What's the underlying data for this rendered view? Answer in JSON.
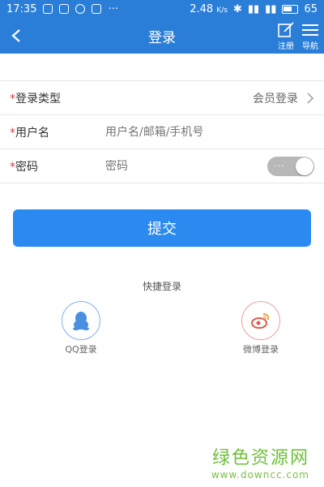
{
  "status_bar": {
    "time": "17:35",
    "speed": "2.48",
    "speed_unit": "K/s",
    "battery": "65"
  },
  "nav": {
    "title": "登录",
    "register_label": "注册",
    "guide_label": "导航"
  },
  "form": {
    "login_type": {
      "required_mark": "*",
      "label": "登录类型",
      "value": "会员登录"
    },
    "username": {
      "required_mark": "*",
      "label": "用户名",
      "placeholder": "用户名/邮箱/手机号"
    },
    "password": {
      "required_mark": "*",
      "label": "密码",
      "placeholder": "密码",
      "show_toggle_dots": "···"
    }
  },
  "submit_label": "提交",
  "quick_login": {
    "title": "快捷登录",
    "qq_label": "QQ登录",
    "weibo_label": "微博登录"
  },
  "watermark": {
    "main": "绿色资源网",
    "sub": "www.downcc.com"
  },
  "colors": {
    "primary": "#2b7ed8",
    "button": "#2b8af0",
    "required": "#e23b3b",
    "qq": "#4a8fe0",
    "weibo": "#e05a4f"
  }
}
